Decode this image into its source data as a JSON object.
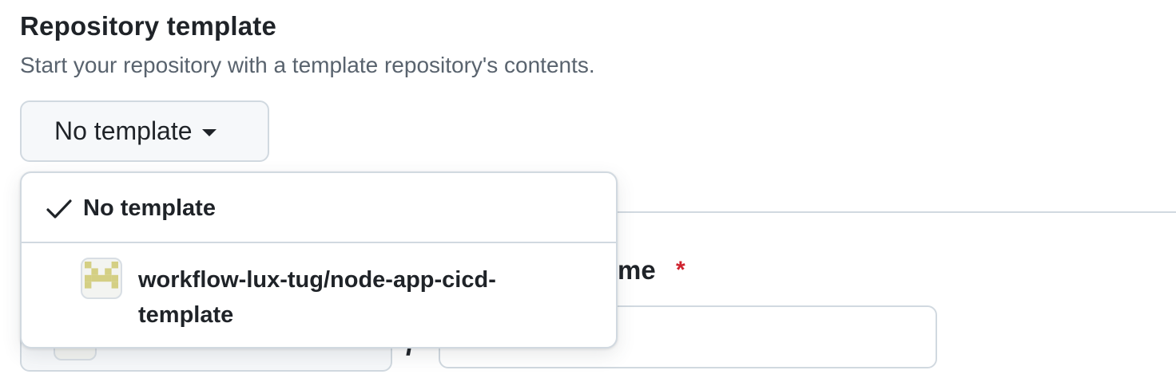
{
  "section": {
    "title": "Repository template",
    "description": "Start your repository with a template repository's contents."
  },
  "template_button": {
    "label": "No template",
    "icon": "caret-down-icon"
  },
  "dropdown": {
    "items": [
      {
        "label": "No template",
        "selected": true,
        "icon": "check-icon"
      },
      {
        "label": "workflow-lux-tug/node-app-cicd-template",
        "selected": false,
        "icon": "avatar-identicon"
      }
    ]
  },
  "form": {
    "repo_name_label_visible": "me",
    "required_marker": "*",
    "owner_separator": "/",
    "repo_name_value": ""
  },
  "colors": {
    "border": "#d1d9e0",
    "button_bg": "#f6f8fa",
    "text": "#1f2328",
    "muted": "#59636e",
    "required": "#cf222e",
    "identicon": "#d4cf84"
  }
}
